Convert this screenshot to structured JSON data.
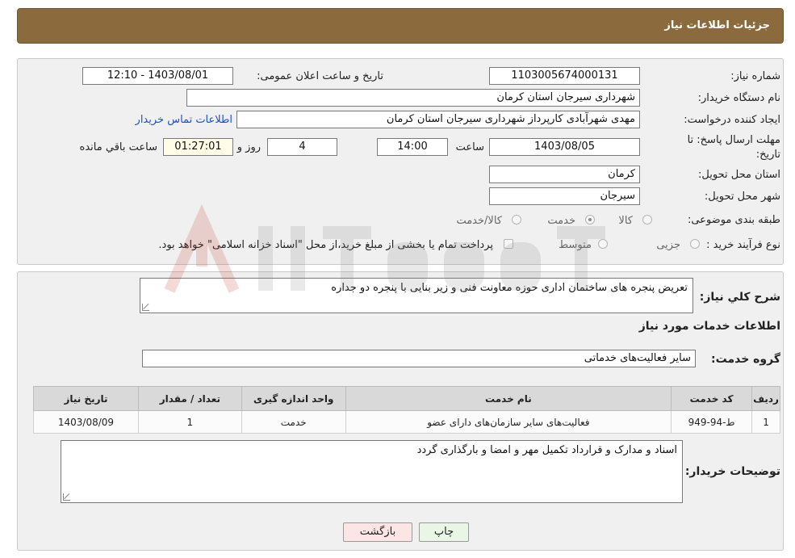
{
  "header": {
    "title": "جزئیات اطلاعات نیاز"
  },
  "form": {
    "need_number": {
      "label": "شماره نیاز:",
      "value": "1103005674000131"
    },
    "announce_datetime": {
      "label": "تاریخ و ساعت اعلان عمومی:",
      "value": "1403/08/01 - 12:10"
    },
    "buyer_org": {
      "label": "نام دستگاه خریدار:",
      "value": "شهرداری سیرجان استان کرمان"
    },
    "requester": {
      "label": "ایجاد کننده درخواست:",
      "value": "مهدی شهرآبادی کارپرداز شهرداری سیرجان استان کرمان",
      "contact_link": "اطلاعات تماس خریدار"
    },
    "deadline": {
      "label_line1": "مهلت ارسال پاسخ: تا",
      "label_line2": "تاریخ:",
      "date": "1403/08/05",
      "time_label": "ساعت",
      "time": "14:00",
      "days": "4",
      "days_label": "روز و",
      "remaining": "01:27:01",
      "remaining_label": "ساعت باقي مانده"
    },
    "delivery_province": {
      "label": "استان محل تحویل:",
      "value": "کرمان"
    },
    "delivery_city": {
      "label": "شهر محل تحویل:",
      "value": "سیرجان"
    },
    "category": {
      "label": "طبقه بندی موضوعی:",
      "options": [
        "کالا",
        "خدمت",
        "کالا/خدمت"
      ],
      "selected": "خدمت"
    },
    "purchase_type": {
      "label": "نوع فرآیند خرید :",
      "options": [
        "جزیی",
        "متوسط"
      ],
      "note": "پرداخت تمام یا بخشی از مبلغ خرید،از محل \"اسناد خزانه اسلامی\" خواهد بود."
    }
  },
  "details": {
    "description_label": "شرح کلي نياز:",
    "description": "تعریض پنجره های ساختمان اداری حوزه معاونت  فنی و زیر بنایی با پنجره دو جداره",
    "services_title": "اطلاعات خدمات مورد نياز",
    "service_group_label": "گروه خدمت:",
    "service_group": "سایر فعالیت‌های خدماتی",
    "table": {
      "headers": [
        "رديف",
        "کد خدمت",
        "نام خدمت",
        "واحد اندازه گيری",
        "تعداد / مقدار",
        "تاريخ نياز"
      ],
      "rows": [
        [
          "1",
          "ط-94-949",
          "فعالیت‌های سایر سازمان‌های دارای عضو",
          "خدمت",
          "1",
          "1403/08/09"
        ]
      ]
    },
    "buyer_notes_label": "توضيحات خريدار:",
    "buyer_notes": "اسناد و مدارک و قرارداد تکمیل مهر و امضا و بارگذاری گردد"
  },
  "buttons": {
    "print": "چاپ",
    "back": "بازگشت"
  },
  "colors": {
    "header_bg": "#8b6b3e",
    "panel_bg": "#f0f0f0",
    "link": "#1a4fd6"
  }
}
